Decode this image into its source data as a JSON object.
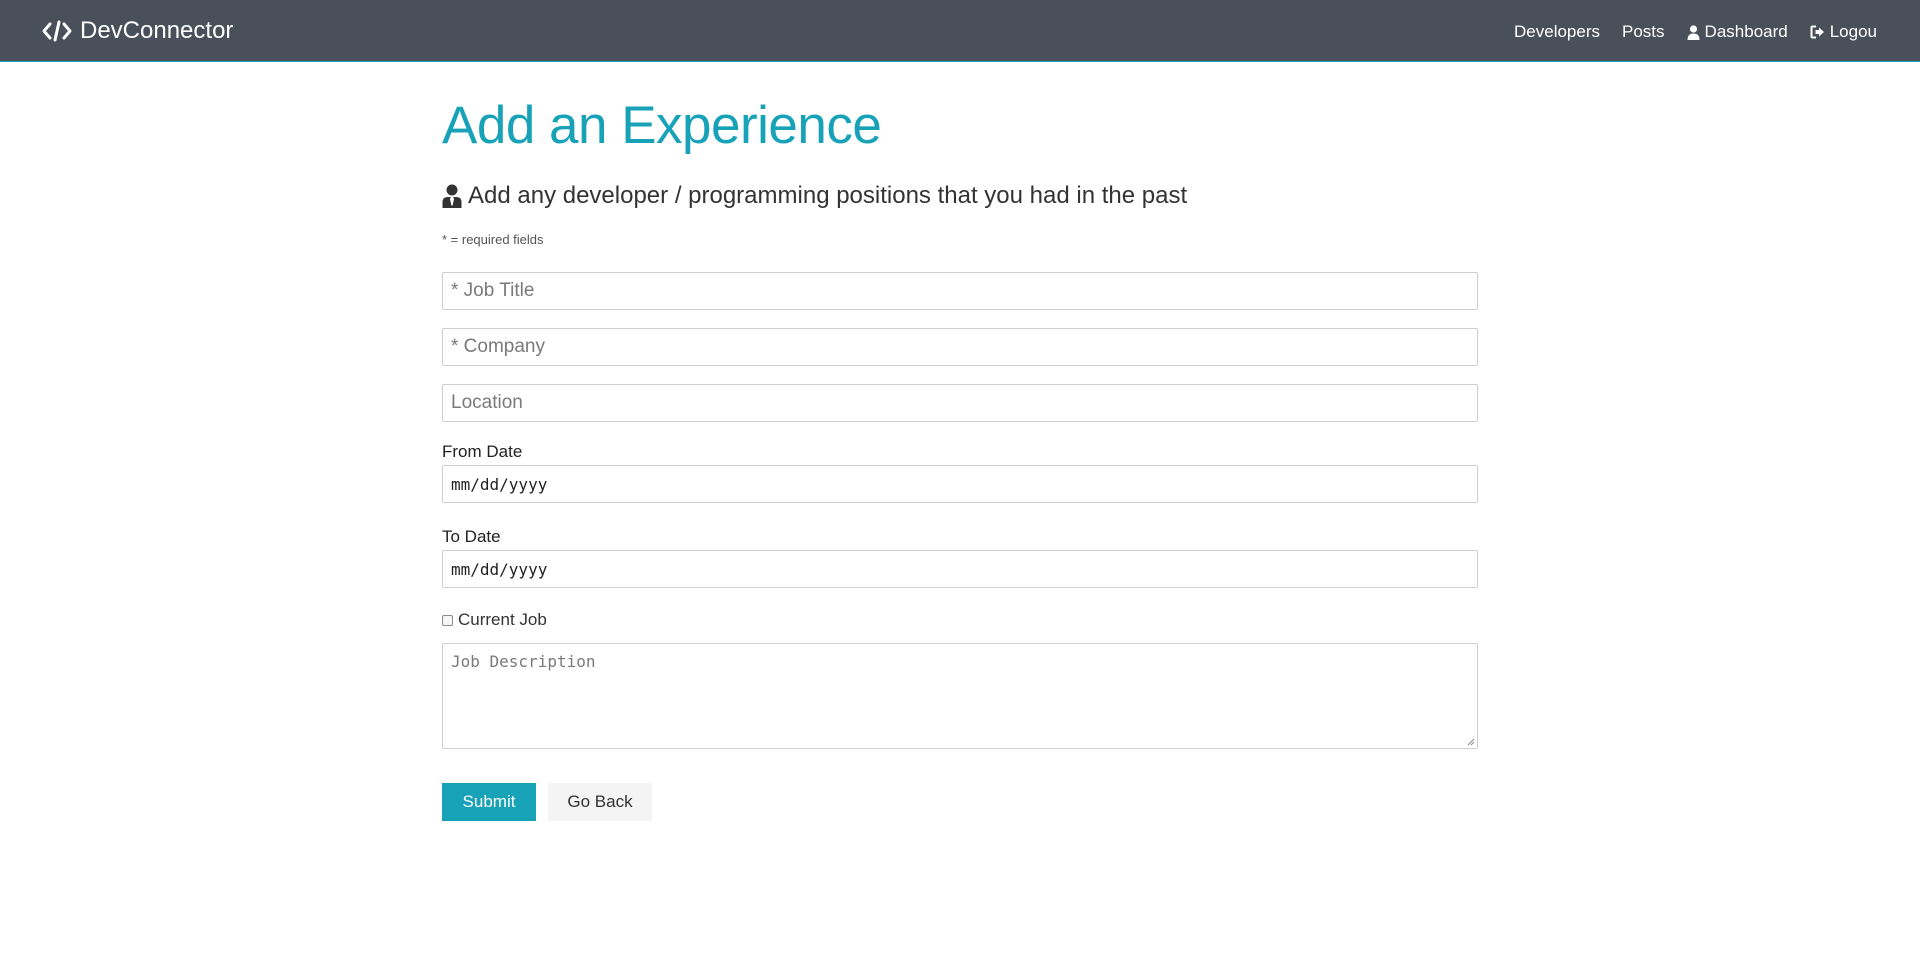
{
  "navbar": {
    "brand": "DevConnector",
    "links": [
      {
        "label": "Developers",
        "icon": ""
      },
      {
        "label": "Posts",
        "icon": ""
      },
      {
        "label": "Dashboard",
        "icon": "user-icon"
      },
      {
        "label": "Logou",
        "icon": "sign-out-icon"
      }
    ]
  },
  "page": {
    "title": "Add an Experience",
    "lead": "Add any developer / programming positions that you had in the past",
    "lead_icon": "user-tie-icon",
    "required_note": "* = required fields"
  },
  "form": {
    "job_title_placeholder": "* Job Title",
    "company_placeholder": "* Company",
    "location_placeholder": "Location",
    "from_label": "From Date",
    "from_value": "mm/dd/yyyy",
    "to_label": "To Date",
    "to_value": "mm/dd/yyyy",
    "current_label": "Current Job",
    "current_checked": false,
    "description_placeholder": "Job Description",
    "submit_label": "Submit",
    "back_label": "Go Back"
  },
  "colors": {
    "navbar_bg": "#495059",
    "primary": "#17a2b8",
    "light_button": "#f4f4f4"
  }
}
